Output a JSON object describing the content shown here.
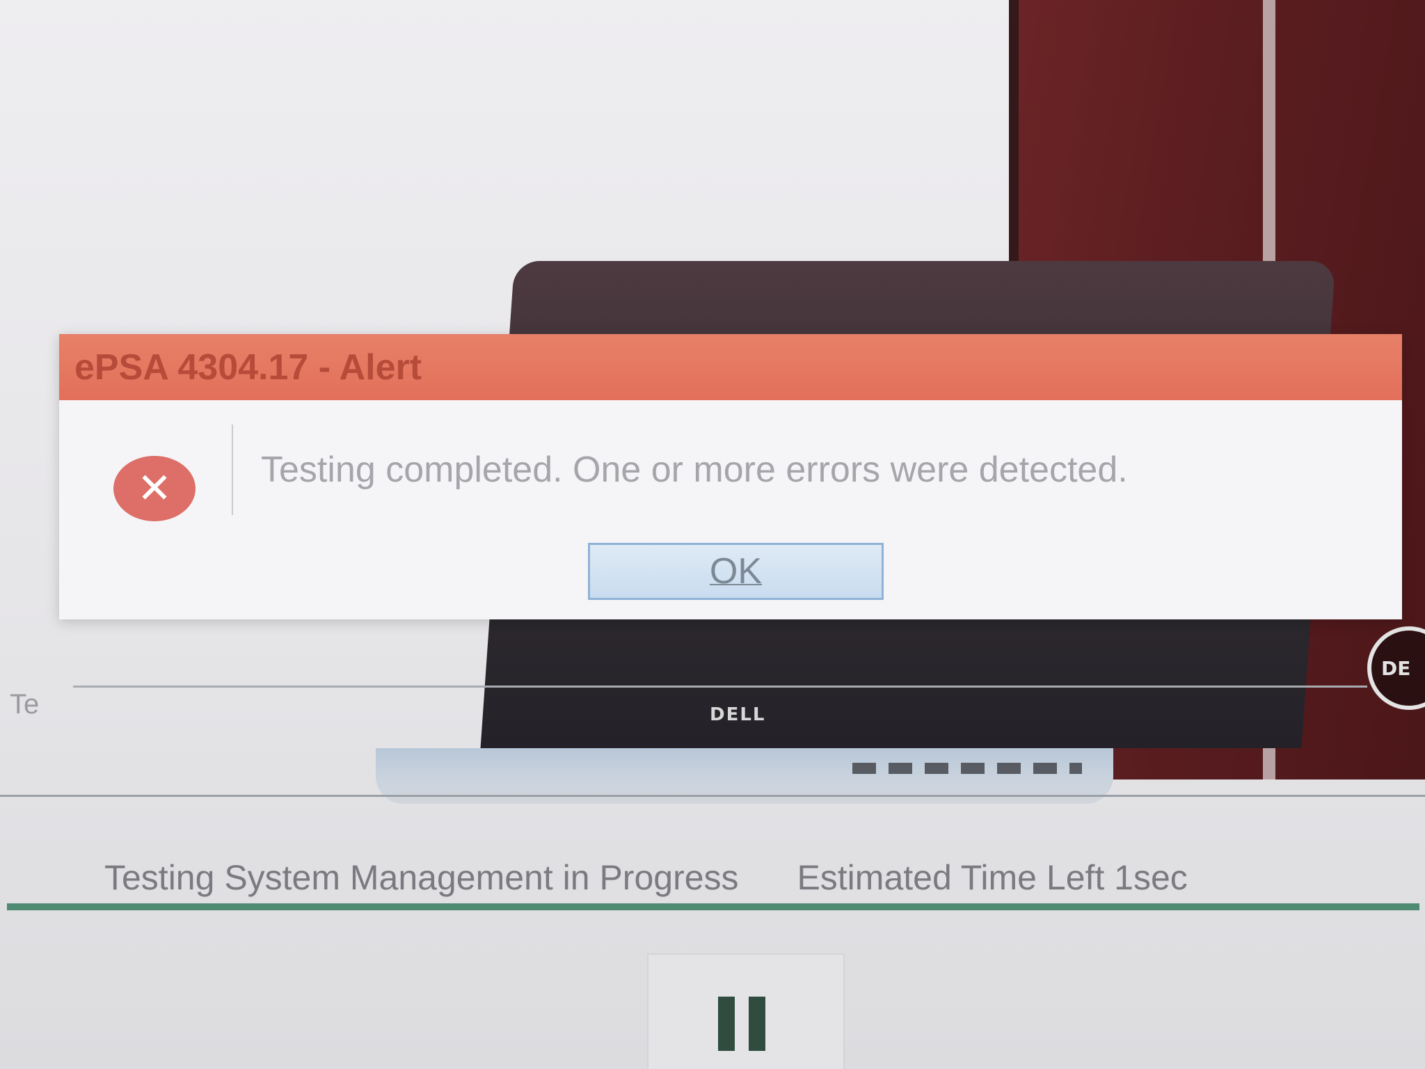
{
  "dialog": {
    "title": "ePSA 4304.17 - Alert",
    "message": "Testing completed. One or more errors were detected.",
    "ok_label": "OK",
    "error_icon_glyph": "✕",
    "icon": "error-icon",
    "titlebar_color": "#e2705a"
  },
  "status": {
    "message": "Testing System Management in Progress",
    "time_left": "Estimated Time Left 1sec",
    "progress_percent": 100,
    "progress_color": "#4f8a72"
  },
  "controls": {
    "pause_icon": "pause-icon"
  },
  "product_image": {
    "laptop_logo": "DELL",
    "tower_badge": "DE"
  },
  "side_mark": "Te"
}
